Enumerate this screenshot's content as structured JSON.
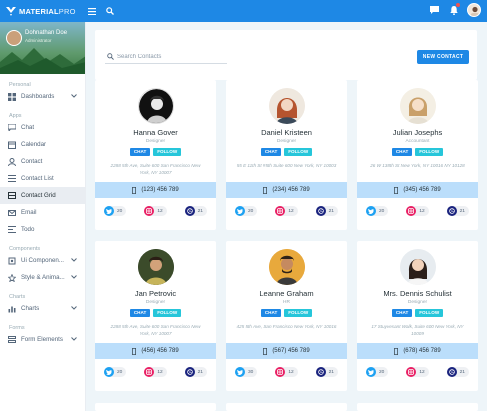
{
  "app": {
    "logo_main": "MATERIAL",
    "logo_pro": "PRO"
  },
  "profile": {
    "name": "Dohnathan Doe",
    "subtitle": "Administrator"
  },
  "sidebar": {
    "sections": [
      {
        "caption": "Personal",
        "items": [
          {
            "label": "Dashboards",
            "icon": "dashboard-icon",
            "chevron": true
          }
        ]
      },
      {
        "caption": "Apps",
        "items": [
          {
            "label": "Chat",
            "icon": "chat-icon"
          },
          {
            "label": "Calendar",
            "icon": "calendar-icon"
          },
          {
            "label": "Contact",
            "icon": "contact-icon"
          },
          {
            "label": "Contact List",
            "icon": "contact-list-icon"
          },
          {
            "label": "Contact Grid",
            "icon": "contact-grid-icon",
            "active": true
          },
          {
            "label": "Email",
            "icon": "email-icon"
          },
          {
            "label": "Todo",
            "icon": "todo-icon"
          }
        ]
      },
      {
        "caption": "Components",
        "items": [
          {
            "label": "Ui Componen...",
            "icon": "ui-components-icon",
            "chevron": true
          },
          {
            "label": "Style & Anima...",
            "icon": "style-icon",
            "chevron": true
          }
        ]
      },
      {
        "caption": "Charts",
        "items": [
          {
            "label": "Charts",
            "icon": "chart-icon",
            "chevron": true
          }
        ]
      },
      {
        "caption": "Forms",
        "items": [
          {
            "label": "Form Elements",
            "icon": "form-icon",
            "chevron": true
          }
        ]
      }
    ]
  },
  "search": {
    "placeholder": "Search Contacts"
  },
  "new_contact_label": "NEW CONTACT",
  "buttons": {
    "chat": "CHAT",
    "follow": "FOLLOW"
  },
  "contacts": [
    {
      "name": "Hanna Gover",
      "role": "Designer",
      "address": "2288 5th Ave, Suite 600 San Francisco New York, NY 10007",
      "phone": "(123) 456 789",
      "twitter": "20",
      "instagram": "12",
      "dribbble": "21"
    },
    {
      "name": "Daniel Kristeen",
      "role": "Designer",
      "address": "55 E 11th St #5th Suite 600 New York, NY 10003",
      "phone": "(234) 456 789",
      "twitter": "20",
      "instagram": "12",
      "dribbble": "21"
    },
    {
      "name": "Julian Josephs",
      "role": "Accountant",
      "address": "26 W 138th St New York, NY 10016 NY 10128",
      "phone": "(345) 456 789",
      "twitter": "20",
      "instagram": "12",
      "dribbble": "21"
    },
    {
      "name": "Jan Petrovic",
      "role": "Designer",
      "address": "2288 5th Ave, Suite 600 San Francisco New York, NY 10007",
      "phone": "(456) 456 789",
      "twitter": "20",
      "instagram": "12",
      "dribbble": "21"
    },
    {
      "name": "Leanne Graham",
      "role": "HR",
      "address": "425 5th Ave, San Francisco New York, NY 10016",
      "phone": "(567) 456 789",
      "twitter": "30",
      "instagram": "12",
      "dribbble": "21"
    },
    {
      "name": "Mrs. Dennis Schulist",
      "role": "Designer",
      "address": "17 Stuyvesant Walk, Suite 600 New York, NY 10009",
      "phone": "(678) 456 789",
      "twitter": "20",
      "instagram": "12",
      "dribbble": "21"
    }
  ],
  "colors": {
    "primary": "#1e88e5",
    "info": "#26c6da",
    "phone_bg": "#bbdefb",
    "twitter": "#1da1f2",
    "instagram": "#e91e63",
    "dribbble": "#1a237e"
  }
}
